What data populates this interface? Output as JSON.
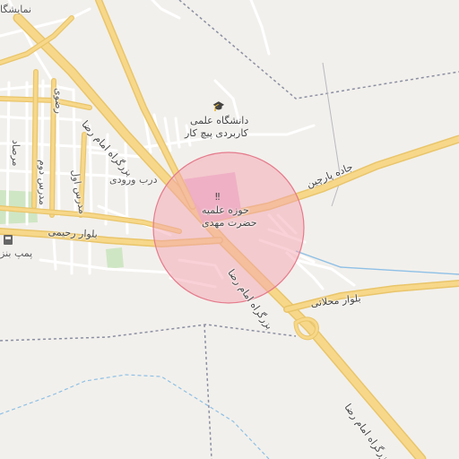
{
  "map": {
    "colors": {
      "background": "#f2f0ec",
      "major_road": "#f7d88a",
      "major_road_casing": "#e9c56a",
      "minor_road": "#ffffff",
      "park": "#cfe6c4",
      "boundary": "#8b8fa3",
      "water_line": "#8ec0e6",
      "highlight_fill": "#f4a4b0",
      "highlight_stroke": "#e57b8c",
      "poi_area": "#e9b4d8"
    },
    "labels": {
      "top_left": "نمایشگا",
      "university_line1": "دانشگاه علمی",
      "university_line2": "کاربردی پیچ کار",
      "hawza_line1": "حوزه علمیه",
      "hawza_line2": "حضرت مهدی",
      "darb_vorudi": "درب ورودی",
      "jadeh_parchin": "جاده پارچین",
      "bolvar_rahimi": "بلوار رحیمی",
      "bolvar_mahallati": "بلوار محلاتی",
      "imam_reza_nw": "بزرگراه امام رضا",
      "imam_reza_mid": "بزرگراه امام رضا",
      "imam_reza_se": "بزرگراه امام رضا",
      "street_modares1": "مدرس اول",
      "street_modares2": "مدرس دوم",
      "street_morsad": "مرصاد",
      "street_razavi": "رضوی",
      "pump_station": "پمپ بنز"
    },
    "icons": {
      "university": "graduation-cap-icon",
      "religious": "religious-school-icon",
      "fuel": "fuel-pump-icon"
    }
  }
}
